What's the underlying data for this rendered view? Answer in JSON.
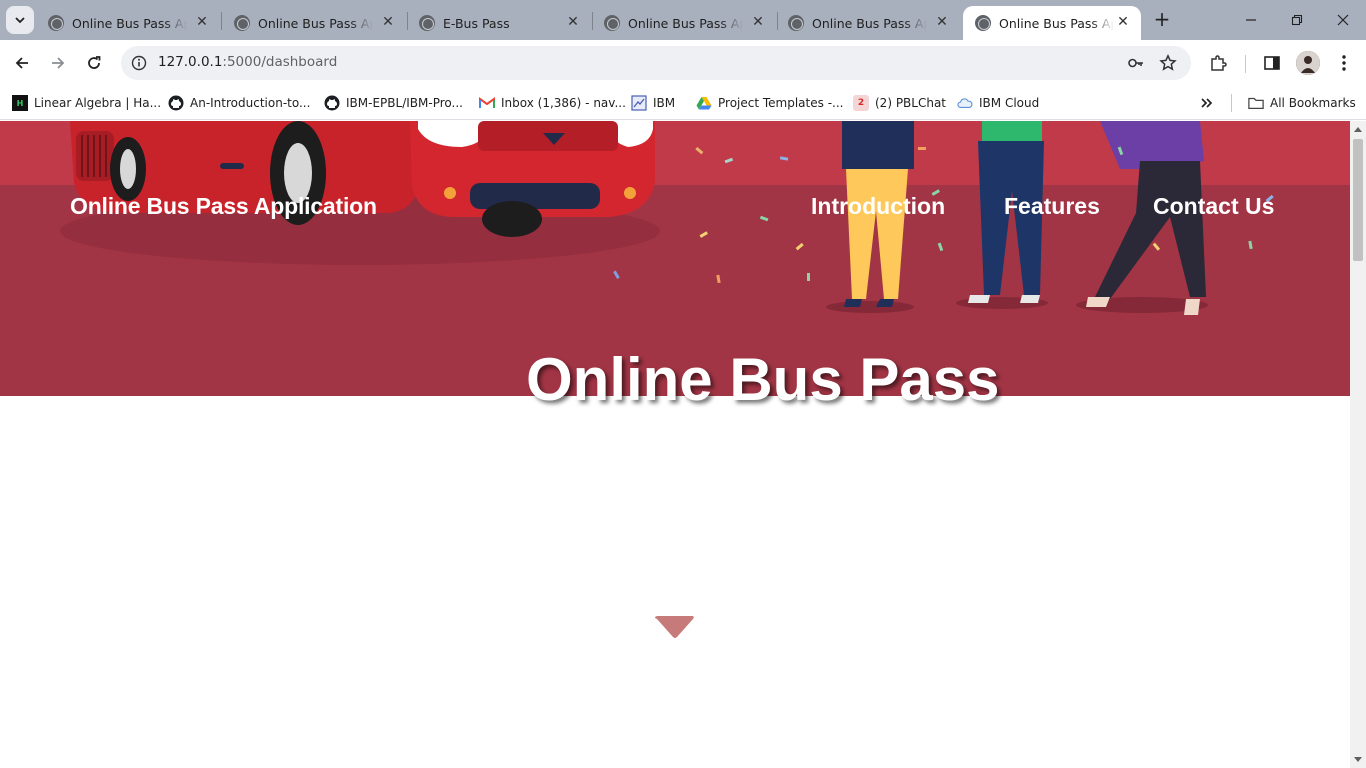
{
  "browser": {
    "tabs": [
      {
        "title": "Online Bus Pass Appl",
        "active": false
      },
      {
        "title": "Online Bus Pass Appl",
        "active": false
      },
      {
        "title": "E-Bus Pass",
        "active": false
      },
      {
        "title": "Online Bus Pass Appl",
        "active": false
      },
      {
        "title": "Online Bus Pass Appl",
        "active": false
      },
      {
        "title": "Online Bus Pass Appl",
        "active": true
      }
    ],
    "address": {
      "host": "127.0.0.1",
      "path": ":5000/dashboard"
    },
    "bookmarks": [
      {
        "label": "Linear Algebra | Ha...",
        "icon": "hacker-rank-icon"
      },
      {
        "label": "An-Introduction-to...",
        "icon": "github-icon"
      },
      {
        "label": "IBM-EPBL/IBM-Pro...",
        "icon": "github-icon"
      },
      {
        "label": "Inbox (1,386) - nav...",
        "icon": "gmail-icon"
      },
      {
        "label": "IBM",
        "icon": "ibm-icon"
      },
      {
        "label": "Project Templates -...",
        "icon": "google-drive-icon"
      },
      {
        "label": "(2) PBLChat",
        "icon": "pblchat-icon"
      },
      {
        "label": "IBM Cloud",
        "icon": "cloud-icon"
      }
    ],
    "all_bookmarks_label": "All Bookmarks"
  },
  "page": {
    "brand": "Online Bus Pass Application",
    "nav": [
      "Introduction",
      "Features",
      "Contact Us"
    ],
    "hero_title": "Online Bus Pass"
  },
  "colors": {
    "hero_band": "#c03a4a",
    "hero_bg": "#a23545",
    "arrow": "#c77a7a",
    "tabstrip": "#a9b0bd"
  }
}
